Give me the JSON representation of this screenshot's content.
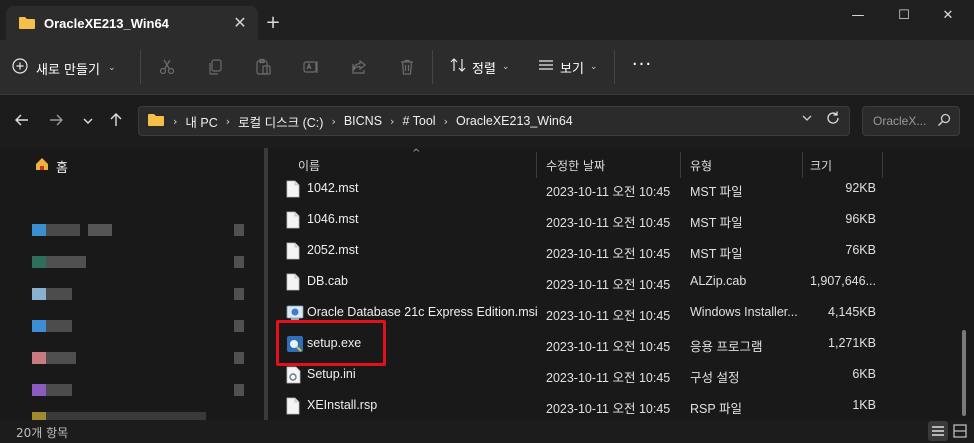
{
  "window": {
    "tab_title": "OracleXE213_Win64",
    "close_tab_label": "✕",
    "new_tab_label": "+",
    "minimize_label": "—",
    "maximize_label": "☐",
    "close_label": "✕"
  },
  "toolbar": {
    "new_label": "새로 만들기",
    "sort_label": "정렬",
    "view_label": "보기",
    "more_label": "···"
  },
  "address": {
    "breadcrumbs": [
      "내 PC",
      "로컬 디스크 (C:)",
      "BICNS",
      "# Tool",
      "OracleXE213_Win64"
    ],
    "search_placeholder": "OracleX..."
  },
  "sidebar": {
    "home_label": "홈"
  },
  "columns": {
    "name": "이름",
    "modified": "수정한 날짜",
    "type": "유형",
    "size": "크기"
  },
  "files": [
    {
      "name": "1042.mst",
      "modified": "2023-10-11 오전 10:45",
      "type": "MST 파일",
      "size": "92KB",
      "icon": "file-icon"
    },
    {
      "name": "1046.mst",
      "modified": "2023-10-11 오전 10:45",
      "type": "MST 파일",
      "size": "96KB",
      "icon": "file-icon"
    },
    {
      "name": "2052.mst",
      "modified": "2023-10-11 오전 10:45",
      "type": "MST 파일",
      "size": "76KB",
      "icon": "file-icon"
    },
    {
      "name": "DB.cab",
      "modified": "2023-10-11 오전 10:45",
      "type": "ALZip.cab",
      "size": "1,907,646...",
      "icon": "file-icon"
    },
    {
      "name": "Oracle Database 21c Express Edition.msi",
      "modified": "2023-10-11 오전 10:45",
      "type": "Windows Installer...",
      "size": "4,145KB",
      "icon": "installer-icon"
    },
    {
      "name": "setup.exe",
      "modified": "2023-10-11 오전 10:45",
      "type": "응용 프로그램",
      "size": "1,271KB",
      "icon": "setup-app-icon"
    },
    {
      "name": "Setup.ini",
      "modified": "2023-10-11 오전 10:45",
      "type": "구성 설정",
      "size": "6KB",
      "icon": "settings-file-icon"
    },
    {
      "name": "XEInstall.rsp",
      "modified": "2023-10-11 오전 10:45",
      "type": "RSP 파일",
      "size": "1KB",
      "icon": "file-icon"
    }
  ],
  "status": {
    "item_count": "20개 항목"
  },
  "colors": {
    "highlight": "#e3101c",
    "folder": "#f5c04a",
    "background": "#191919"
  }
}
